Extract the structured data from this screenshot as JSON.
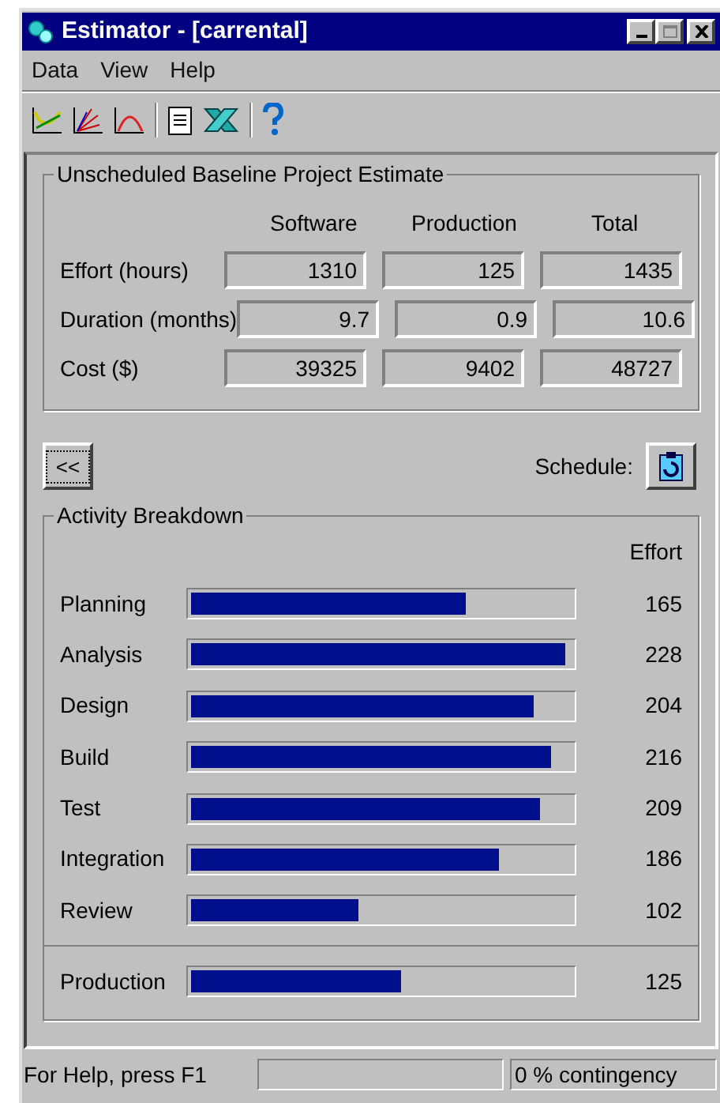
{
  "window": {
    "title": "Estimator - [carrental]"
  },
  "menu": [
    "Data",
    "View",
    "Help"
  ],
  "estimate": {
    "title": "Unscheduled Baseline Project Estimate",
    "columns": [
      "Software",
      "Production",
      "Total"
    ],
    "rows": [
      {
        "label": "Effort (hours)",
        "values": [
          "1310",
          "125",
          "1435"
        ]
      },
      {
        "label": "Duration (months)",
        "values": [
          "9.7",
          "0.9",
          "10.6"
        ]
      },
      {
        "label": "Cost ($)",
        "values": [
          "39325",
          "9402",
          "48727"
        ]
      }
    ]
  },
  "back_button": "<<",
  "schedule_label": "Schedule:",
  "activities": {
    "title": "Activity Breakdown",
    "column": "Effort",
    "rows": [
      {
        "label": "Planning",
        "level": 0.72,
        "value": "165"
      },
      {
        "label": "Analysis",
        "level": 0.985,
        "value": "228"
      },
      {
        "label": "Design",
        "level": 0.9,
        "value": "204"
      },
      {
        "label": "Build",
        "level": 0.945,
        "value": "216"
      },
      {
        "label": "Test",
        "level": 0.915,
        "value": "209"
      },
      {
        "label": "Integration",
        "level": 0.81,
        "value": "186"
      },
      {
        "label": "Review",
        "level": 0.44,
        "value": "102"
      }
    ],
    "production": {
      "label": "Production",
      "level": 0.55,
      "value": "125"
    }
  },
  "status_bar": {
    "help": "For Help, press F1",
    "contingency": "0 % contingency"
  }
}
